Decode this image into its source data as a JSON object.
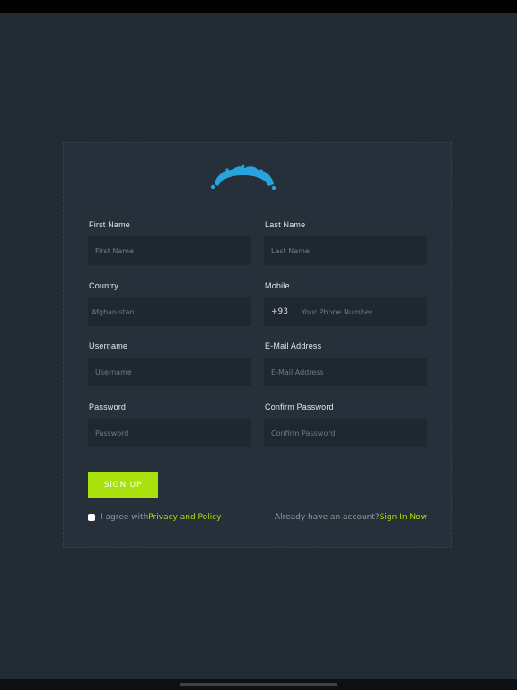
{
  "form": {
    "fields": {
      "first_name": {
        "label": "First Name",
        "placeholder": "First Name"
      },
      "last_name": {
        "label": "Last Name",
        "placeholder": "Last Name"
      },
      "country": {
        "label": "Country",
        "value": "Afghanistan"
      },
      "mobile": {
        "label": "Mobile",
        "code": "+93",
        "placeholder": "Your Phone Number"
      },
      "username": {
        "label": "Username",
        "placeholder": "Username"
      },
      "email": {
        "label": "E-Mail Address",
        "placeholder": "E-Mail Address"
      },
      "password": {
        "label": "Password",
        "placeholder": "Password"
      },
      "confirm_password": {
        "label": "Confirm Password",
        "placeholder": "Confirm Password"
      }
    },
    "signup_label": "SIGN UP",
    "agree_text": "I agree with ",
    "policy_link": "Privacy and Policy",
    "account_text": "Already have an account? ",
    "signin_link": "Sign In Now"
  },
  "colors": {
    "background": "#222c35",
    "card": "#25303a",
    "input": "#1f2831",
    "accent": "#a8e10c",
    "logo": "#29a3dd"
  },
  "icons": {
    "logo": "cloud-arc-logo"
  }
}
